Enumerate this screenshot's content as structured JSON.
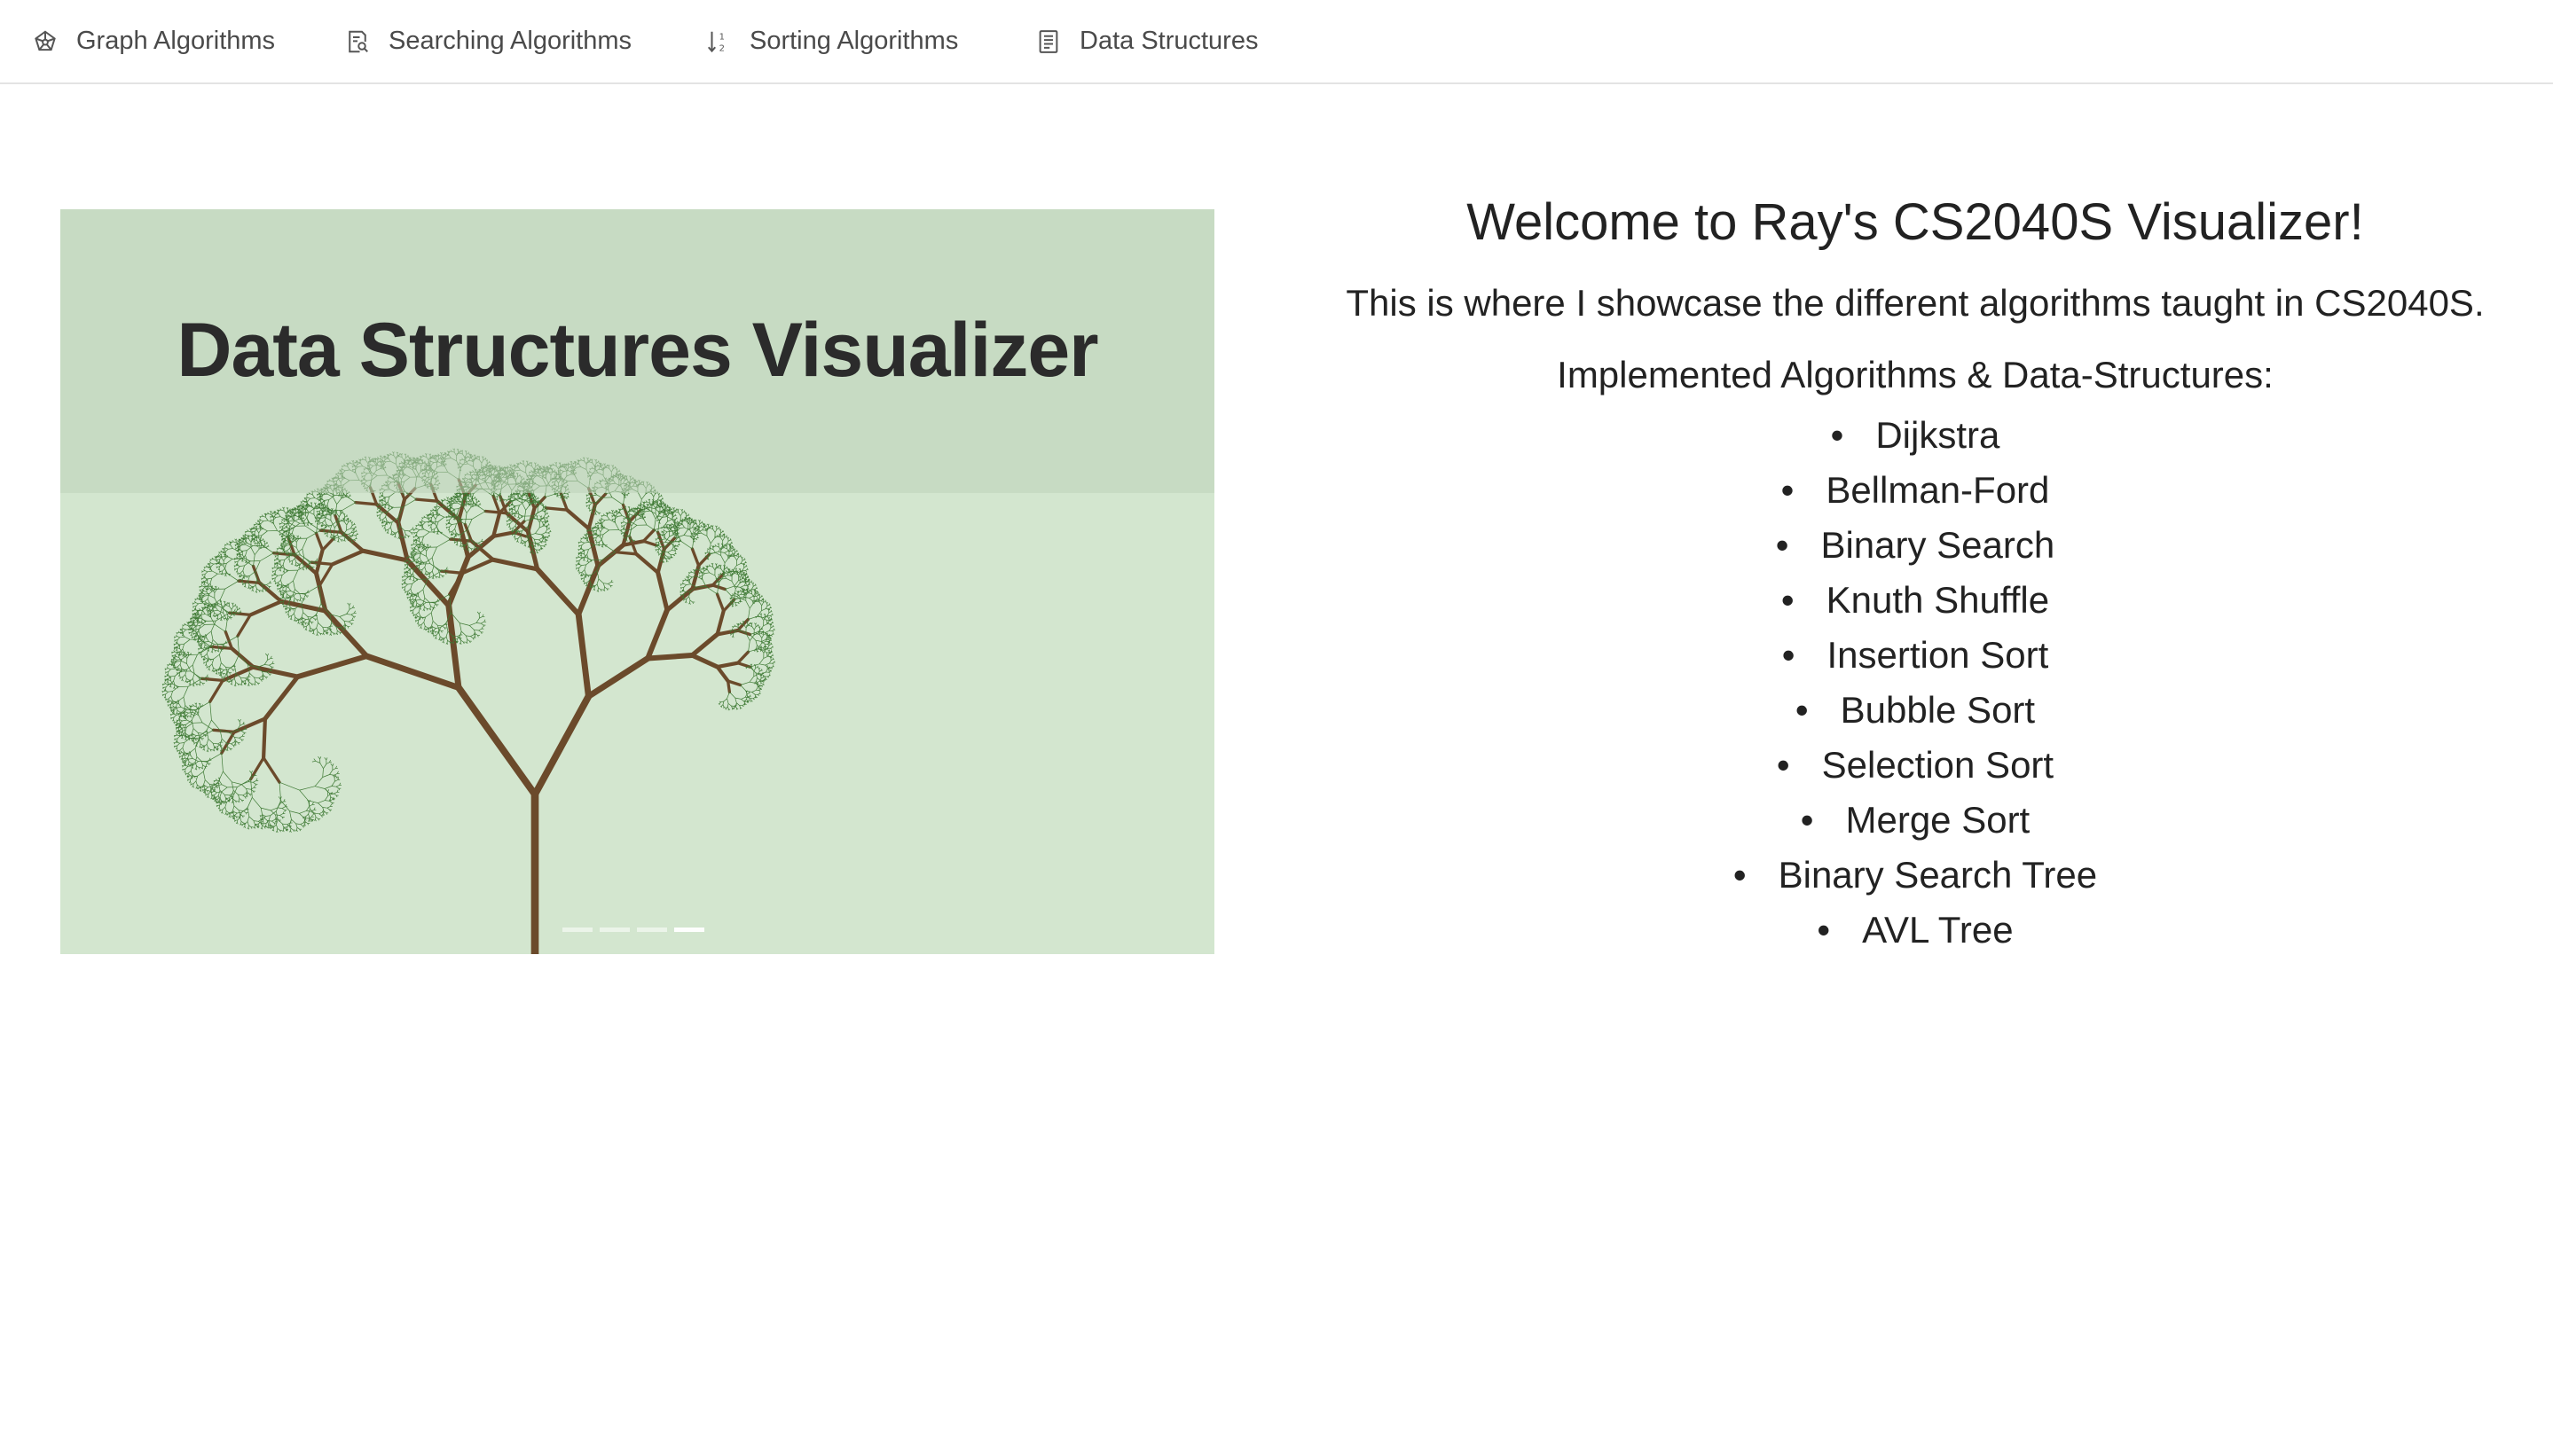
{
  "nav": {
    "items": [
      {
        "label": "Graph Algorithms",
        "icon": "graph-icon"
      },
      {
        "label": "Searching Algorithms",
        "icon": "search-doc-icon"
      },
      {
        "label": "Sorting Algorithms",
        "icon": "sort-icon"
      },
      {
        "label": "Data Structures",
        "icon": "list-doc-icon"
      }
    ]
  },
  "carousel": {
    "slide_title": "Data Structures Visualizer",
    "slide_count": 4,
    "active_index": 3
  },
  "intro": {
    "heading": "Welcome to Ray's CS2040S Visualizer!",
    "tagline": "This is where I showcase the different algorithms taught in CS2040S.",
    "implemented_heading": "Implemented Algorithms & Data-Structures:",
    "items": [
      "Dijkstra",
      "Bellman-Ford",
      "Binary Search",
      "Knuth Shuffle",
      "Insertion Sort",
      "Bubble Sort",
      "Selection Sort",
      "Merge Sort",
      "Binary Search Tree",
      "AVL Tree"
    ]
  },
  "colors": {
    "slide_bg": "#d3e6cf",
    "branch": "#6b4a2b",
    "leaf": "#3f7a35",
    "text": "#222222"
  }
}
